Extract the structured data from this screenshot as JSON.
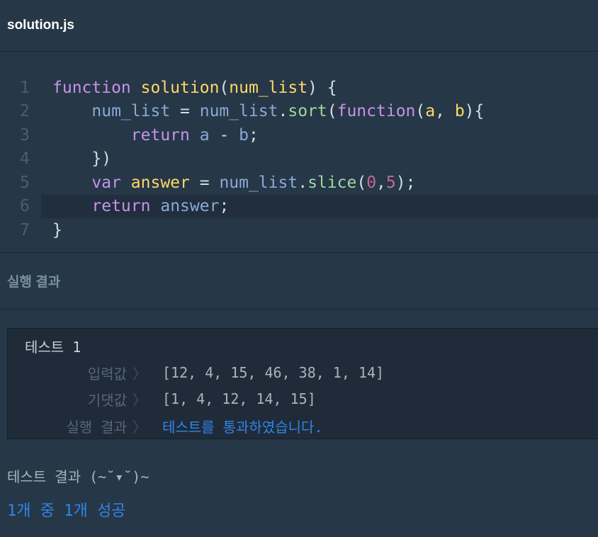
{
  "tab": {
    "title": "solution.js"
  },
  "editor": {
    "lines": [
      {
        "num": "1",
        "tokens": [
          {
            "t": "function",
            "c": "kw"
          },
          {
            "t": " ",
            "c": "pl"
          },
          {
            "t": "solution",
            "c": "fn"
          },
          {
            "t": "(",
            "c": "pl"
          },
          {
            "t": "num_list",
            "c": "fn"
          },
          {
            "t": ") {",
            "c": "pl"
          }
        ]
      },
      {
        "num": "2",
        "tokens": [
          {
            "t": "    ",
            "c": "pl"
          },
          {
            "t": "num_list",
            "c": "var"
          },
          {
            "t": " = ",
            "c": "pl"
          },
          {
            "t": "num_list",
            "c": "var"
          },
          {
            "t": ".",
            "c": "pl"
          },
          {
            "t": "sort",
            "c": "mt"
          },
          {
            "t": "(",
            "c": "pl"
          },
          {
            "t": "function",
            "c": "kw"
          },
          {
            "t": "(",
            "c": "pl"
          },
          {
            "t": "a",
            "c": "fn"
          },
          {
            "t": ", ",
            "c": "pl"
          },
          {
            "t": "b",
            "c": "fn"
          },
          {
            "t": "){",
            "c": "pl"
          }
        ]
      },
      {
        "num": "3",
        "tokens": [
          {
            "t": "        ",
            "c": "pl"
          },
          {
            "t": "return",
            "c": "kw"
          },
          {
            "t": " ",
            "c": "pl"
          },
          {
            "t": "a",
            "c": "var"
          },
          {
            "t": " - ",
            "c": "pl"
          },
          {
            "t": "b",
            "c": "var"
          },
          {
            "t": ";",
            "c": "pl"
          }
        ]
      },
      {
        "num": "4",
        "tokens": [
          {
            "t": "    })",
            "c": "pl"
          }
        ]
      },
      {
        "num": "5",
        "tokens": [
          {
            "t": "    ",
            "c": "pl"
          },
          {
            "t": "var",
            "c": "kw"
          },
          {
            "t": " ",
            "c": "pl"
          },
          {
            "t": "answer",
            "c": "fn"
          },
          {
            "t": " = ",
            "c": "pl"
          },
          {
            "t": "num_list",
            "c": "var"
          },
          {
            "t": ".",
            "c": "pl"
          },
          {
            "t": "slice",
            "c": "mt"
          },
          {
            "t": "(",
            "c": "pl"
          },
          {
            "t": "0",
            "c": "num"
          },
          {
            "t": ",",
            "c": "pl"
          },
          {
            "t": "5",
            "c": "num"
          },
          {
            "t": ");",
            "c": "pl"
          }
        ]
      },
      {
        "num": "6",
        "active": true,
        "tokens": [
          {
            "t": "    ",
            "c": "pl"
          },
          {
            "t": "return",
            "c": "kw"
          },
          {
            "t": " ",
            "c": "pl"
          },
          {
            "t": "answer",
            "c": "var"
          },
          {
            "t": ";",
            "c": "pl"
          }
        ]
      },
      {
        "num": "7",
        "tokens": [
          {
            "t": "}",
            "c": "pl"
          }
        ]
      }
    ]
  },
  "results": {
    "title": "실행 결과",
    "test": {
      "name": "테스트 1",
      "input_label": "입력값",
      "input_value": "[12, 4, 15, 46, 38, 1, 14]",
      "expected_label": "기댓값",
      "expected_value": "[1, 4, 12, 14, 15]",
      "result_label": "실행 결과",
      "result_value": "테스트를 통과하였습니다.",
      "chevron": "〉"
    }
  },
  "summary": {
    "label": "테스트 결과 (~˘▾˘)~",
    "value": "1개 중 1개 성공"
  }
}
